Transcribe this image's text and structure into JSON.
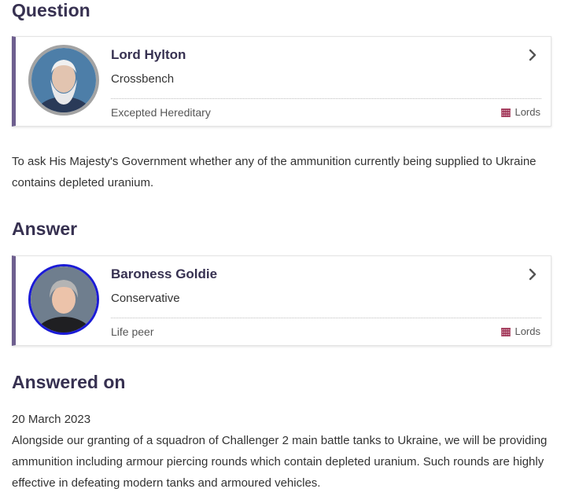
{
  "question": {
    "heading": "Question",
    "member": {
      "name": "Lord Hylton",
      "party": "Crossbench",
      "type": "Excepted Hereditary",
      "house": "Lords",
      "ring_color": "#a3a3a3"
    },
    "text": "To ask His Majesty's Government whether any of the ammunition currently being supplied to Ukraine contains depleted uranium."
  },
  "answer": {
    "heading": "Answer",
    "member": {
      "name": "Baroness Goldie",
      "party": "Conservative",
      "type": "Life peer",
      "house": "Lords",
      "ring_color": "#1b1bd6"
    }
  },
  "answered_on": {
    "heading": "Answered on",
    "date": "20 March 2023",
    "text": "Alongside our granting of a squadron of Challenger 2 main battle tanks to Ukraine, we will be providing ammunition including armour piercing rounds which contain depleted uranium. Such rounds are highly effective in defeating modern tanks and armoured vehicles."
  },
  "colors": {
    "heading": "#373151",
    "card_accent": "#6e5f8f",
    "lords_icon": "#9c2a4e"
  },
  "icons": [
    "chevron-right-icon",
    "portcullis-icon"
  ]
}
